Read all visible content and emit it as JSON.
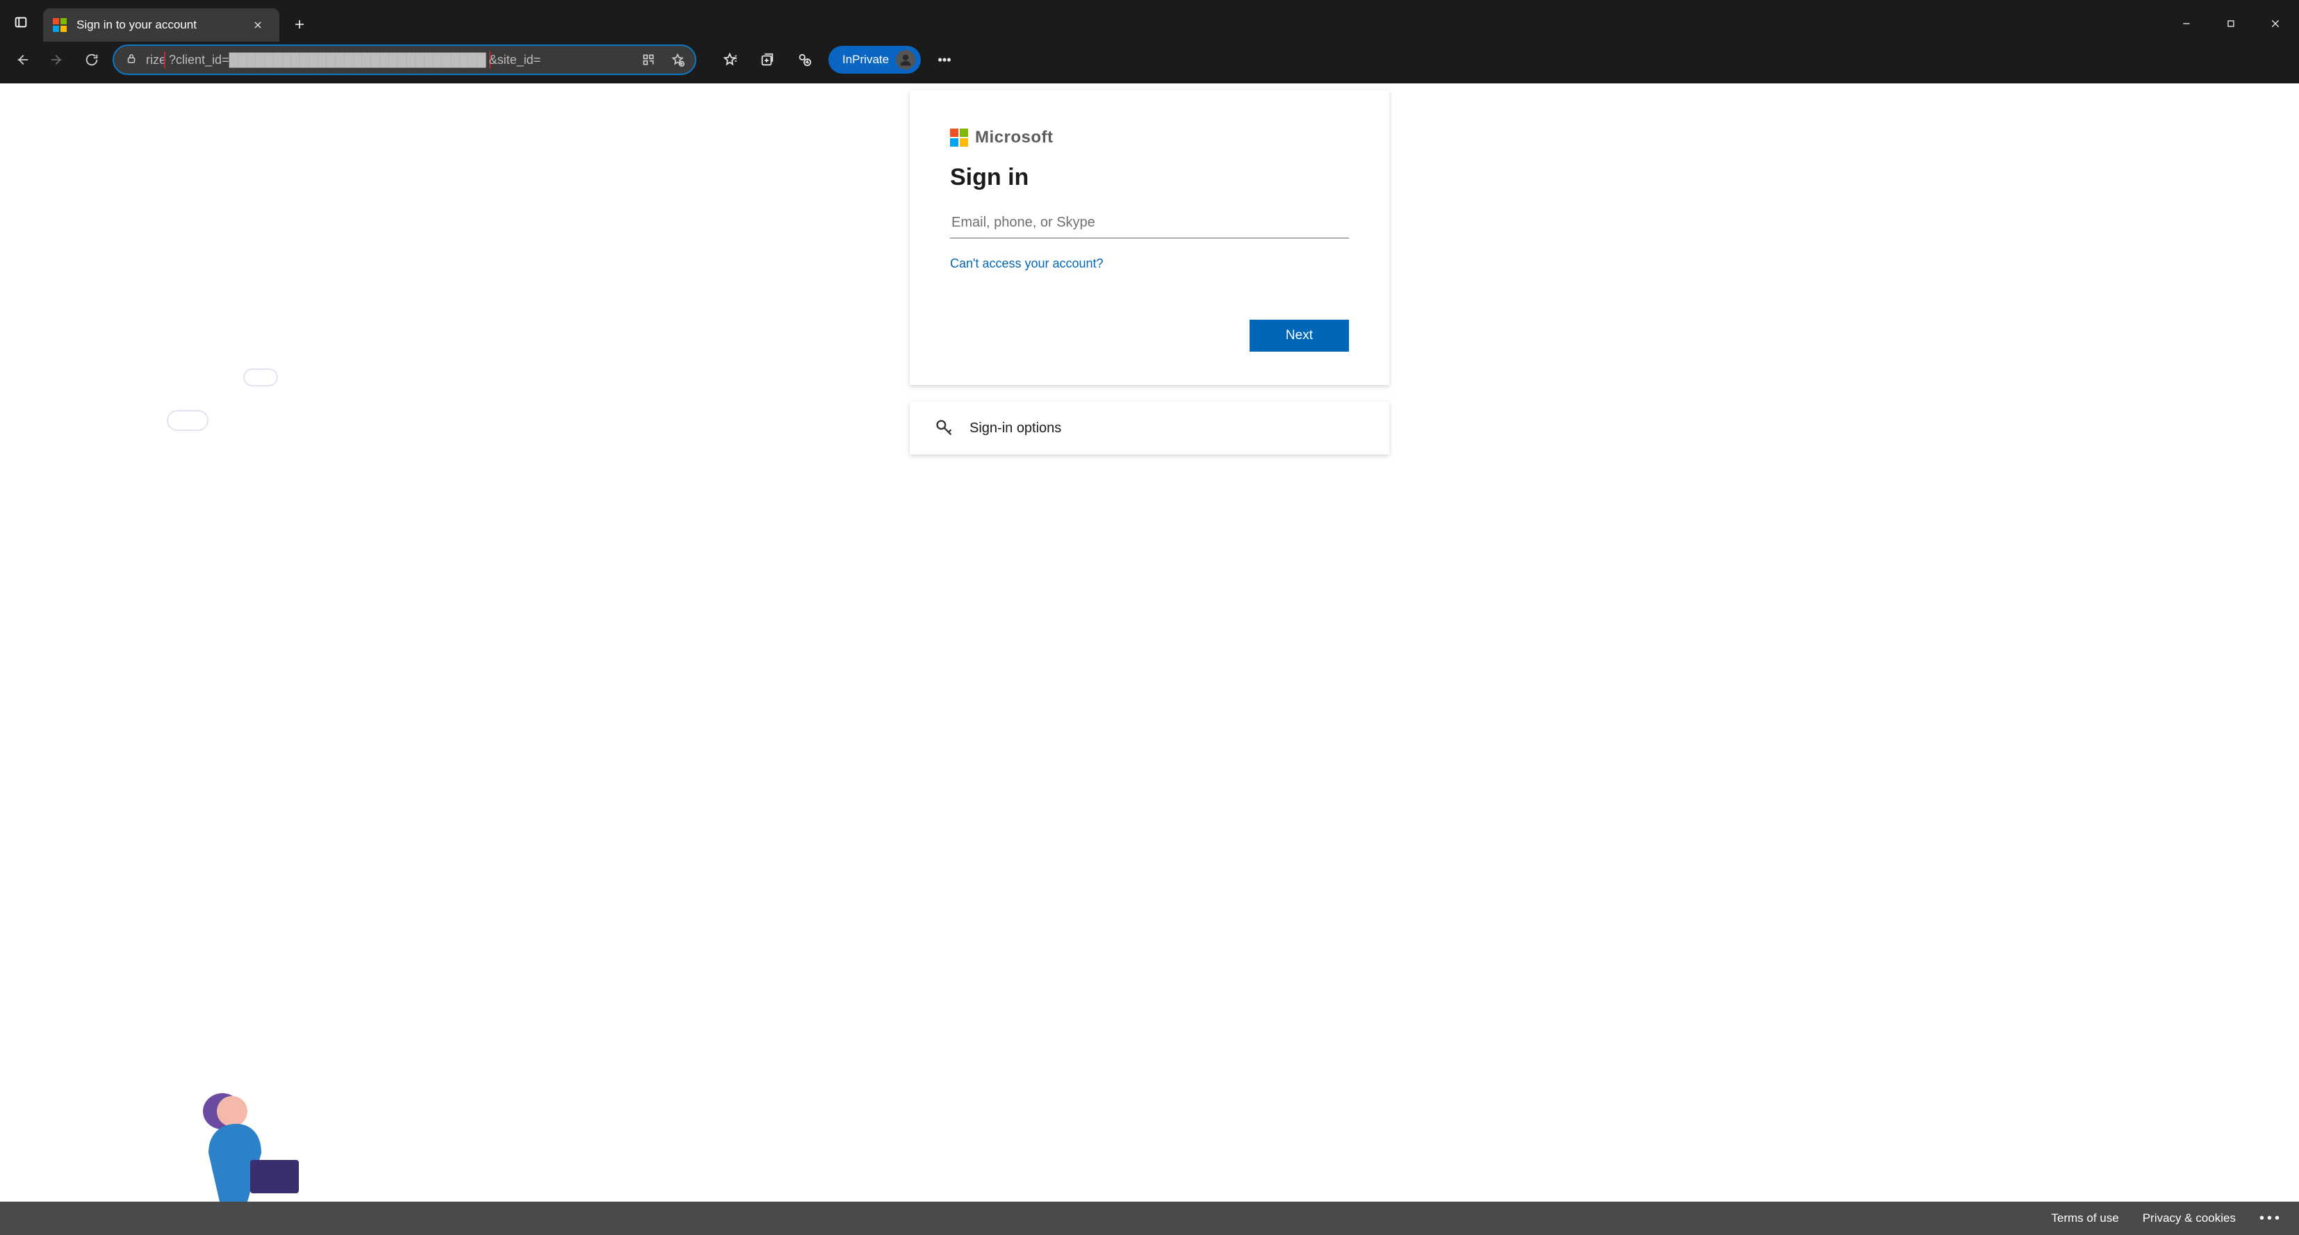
{
  "browser": {
    "tab_title": "Sign in to your account",
    "url_prefix": "rize",
    "url_query_left": "?client_id=",
    "url_redacted": "█████████████████████████████",
    "url_query_right": "&site_id=",
    "inprivate_label": "InPrivate"
  },
  "signin": {
    "brand": "Microsoft",
    "heading": "Sign in",
    "placeholder": "Email, phone, or Skype",
    "help_link": "Can't access your account?",
    "next_label": "Next",
    "options_label": "Sign-in options"
  },
  "footer": {
    "terms": "Terms of use",
    "privacy": "Privacy & cookies"
  }
}
